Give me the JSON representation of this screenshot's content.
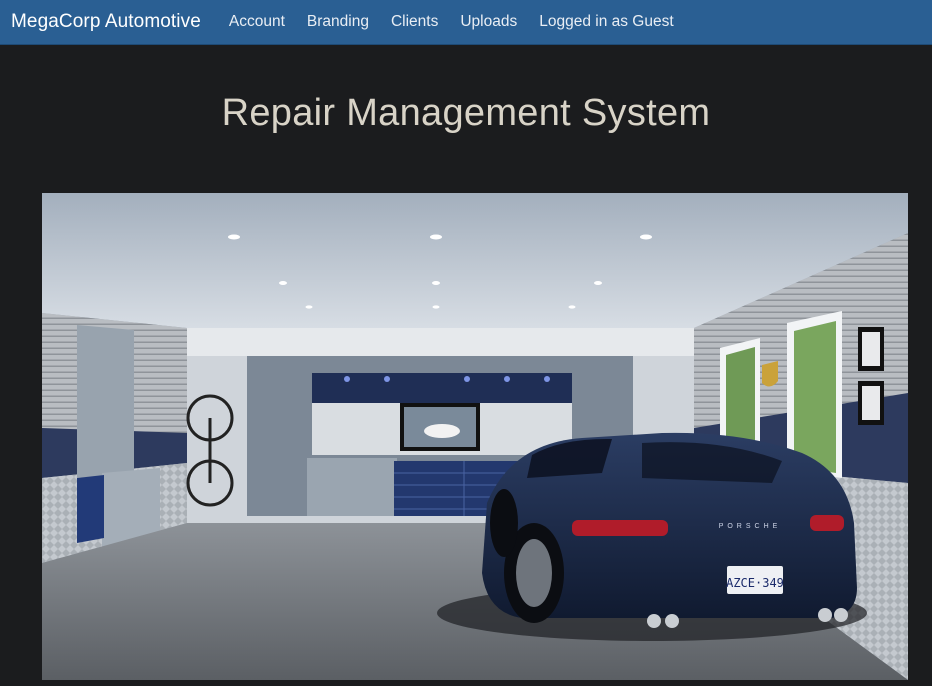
{
  "navbar": {
    "brand": "MegaCorp Automotive",
    "links": [
      {
        "label": "Account"
      },
      {
        "label": "Branding"
      },
      {
        "label": "Clients"
      },
      {
        "label": "Uploads"
      }
    ],
    "login_status": "Logged in as Guest"
  },
  "main": {
    "title": "Repair Management System",
    "hero": {
      "plate_text": "AZCE·349",
      "rear_badge": "PORSCHE"
    }
  },
  "colors": {
    "navbar_bg": "#2a5f93",
    "page_bg": "#1b1c1e",
    "title_text": "#d8d3c7",
    "car_body": "#1a2a4a"
  }
}
